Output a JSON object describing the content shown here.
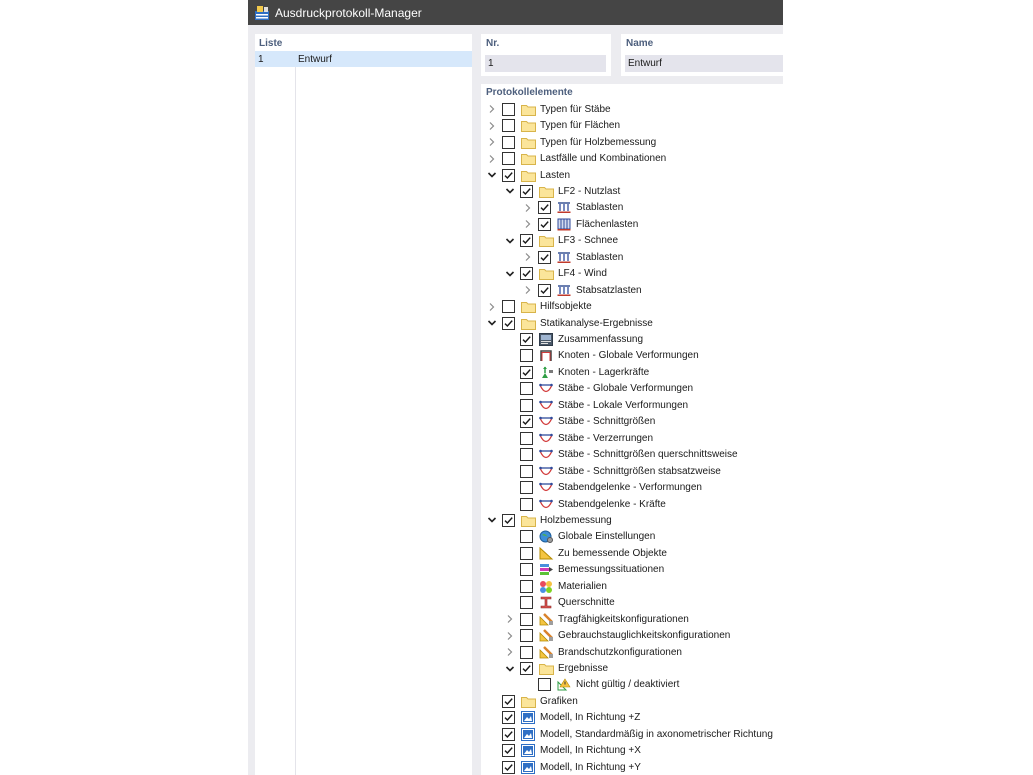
{
  "window": {
    "title": "Ausdruckprotokoll-Manager"
  },
  "list_panel": {
    "header": "Liste",
    "rows": [
      {
        "nr": "1",
        "name": "Entwurf"
      }
    ]
  },
  "nr_field": {
    "label": "Nr.",
    "value": "1"
  },
  "name_field": {
    "label": "Name",
    "value": "Entwurf"
  },
  "tree": {
    "header": "Protokollelemente",
    "items": [
      {
        "label": "Typen für Stäbe",
        "level": 0,
        "expander": "collapsed",
        "checked": false,
        "icon": "folder-icon"
      },
      {
        "label": "Typen für Flächen",
        "level": 0,
        "expander": "collapsed",
        "checked": false,
        "icon": "folder-icon"
      },
      {
        "label": "Typen für Holzbemessung",
        "level": 0,
        "expander": "collapsed",
        "checked": false,
        "icon": "folder-icon"
      },
      {
        "label": "Lastfälle und Kombinationen",
        "level": 0,
        "expander": "collapsed",
        "checked": false,
        "icon": "folder-icon"
      },
      {
        "label": "Lasten",
        "level": 0,
        "expander": "expanded",
        "checked": true,
        "icon": "folder-icon"
      },
      {
        "label": "LF2 - Nutzlast",
        "level": 1,
        "expander": "expanded",
        "checked": true,
        "icon": "folder-icon"
      },
      {
        "label": "Stablasten",
        "level": 2,
        "expander": "collapsed",
        "checked": true,
        "icon": "member-load-icon"
      },
      {
        "label": "Flächenlasten",
        "level": 2,
        "expander": "collapsed",
        "checked": true,
        "icon": "surface-load-icon"
      },
      {
        "label": "LF3 - Schnee",
        "level": 1,
        "expander": "expanded",
        "checked": true,
        "icon": "folder-icon"
      },
      {
        "label": "Stablasten",
        "level": 2,
        "expander": "collapsed",
        "checked": true,
        "icon": "member-load-icon"
      },
      {
        "label": "LF4 - Wind",
        "level": 1,
        "expander": "expanded",
        "checked": true,
        "icon": "folder-icon"
      },
      {
        "label": "Stabsatzlasten",
        "level": 2,
        "expander": "collapsed",
        "checked": true,
        "icon": "member-load-icon"
      },
      {
        "label": "Hilfsobjekte",
        "level": 0,
        "expander": "collapsed",
        "checked": false,
        "icon": "folder-icon"
      },
      {
        "label": "Statikanalyse-Ergebnisse",
        "level": 0,
        "expander": "expanded",
        "checked": true,
        "icon": "folder-icon"
      },
      {
        "label": "Zusammenfassung",
        "level": 1,
        "expander": "none",
        "checked": true,
        "icon": "summary-icon"
      },
      {
        "label": "Knoten - Globale Verformungen",
        "level": 1,
        "expander": "none",
        "checked": false,
        "icon": "node-deformation-icon"
      },
      {
        "label": "Knoten - Lagerkräfte",
        "level": 1,
        "expander": "none",
        "checked": true,
        "icon": "support-force-icon"
      },
      {
        "label": "Stäbe - Globale Verformungen",
        "level": 1,
        "expander": "none",
        "checked": false,
        "icon": "member-result-icon"
      },
      {
        "label": "Stäbe - Lokale Verformungen",
        "level": 1,
        "expander": "none",
        "checked": false,
        "icon": "member-result-icon"
      },
      {
        "label": "Stäbe - Schnittgrößen",
        "level": 1,
        "expander": "none",
        "checked": true,
        "icon": "member-result-icon"
      },
      {
        "label": "Stäbe - Verzerrungen",
        "level": 1,
        "expander": "none",
        "checked": false,
        "icon": "member-result-icon"
      },
      {
        "label": "Stäbe - Schnittgrößen querschnittsweise",
        "level": 1,
        "expander": "none",
        "checked": false,
        "icon": "member-result-icon"
      },
      {
        "label": "Stäbe - Schnittgrößen stabsatzweise",
        "level": 1,
        "expander": "none",
        "checked": false,
        "icon": "member-result-icon"
      },
      {
        "label": "Stabendgelenke - Verformungen",
        "level": 1,
        "expander": "none",
        "checked": false,
        "icon": "member-result-icon"
      },
      {
        "label": "Stabendgelenke - Kräfte",
        "level": 1,
        "expander": "none",
        "checked": false,
        "icon": "member-result-icon"
      },
      {
        "label": "Holzbemessung",
        "level": 0,
        "expander": "expanded",
        "checked": true,
        "icon": "folder-icon"
      },
      {
        "label": "Globale Einstellungen",
        "level": 1,
        "expander": "none",
        "checked": false,
        "icon": "globe-settings-icon"
      },
      {
        "label": "Zu bemessende Objekte",
        "level": 1,
        "expander": "none",
        "checked": false,
        "icon": "design-objects-icon"
      },
      {
        "label": "Bemessungssituationen",
        "level": 1,
        "expander": "none",
        "checked": false,
        "icon": "design-situations-icon"
      },
      {
        "label": "Materialien",
        "level": 1,
        "expander": "none",
        "checked": false,
        "icon": "materials-icon"
      },
      {
        "label": "Querschnitte",
        "level": 1,
        "expander": "none",
        "checked": false,
        "icon": "cross-section-icon"
      },
      {
        "label": "Tragfähigkeitskonfigurationen",
        "level": 1,
        "expander": "collapsed",
        "checked": false,
        "icon": "configuration-icon"
      },
      {
        "label": "Gebrauchstauglichkeitskonfigurationen",
        "level": 1,
        "expander": "collapsed",
        "checked": false,
        "icon": "configuration-icon"
      },
      {
        "label": "Brandschutzkonfigurationen",
        "level": 1,
        "expander": "collapsed",
        "checked": false,
        "icon": "configuration-icon"
      },
      {
        "label": "Ergebnisse",
        "level": 1,
        "expander": "expanded",
        "checked": true,
        "icon": "folder-icon"
      },
      {
        "label": "Nicht gültig / deaktiviert",
        "level": 2,
        "expander": "none",
        "checked": false,
        "icon": "invalid-warning-icon"
      },
      {
        "label": "Grafiken",
        "level": 0,
        "expander": "none",
        "checked": true,
        "icon": "folder-icon"
      },
      {
        "label": "Modell, In Richtung +Z",
        "level": 0,
        "expander": "none",
        "checked": true,
        "icon": "graphic-image-icon"
      },
      {
        "label": "Modell, Standardmäßig in axonometrischer Richtung",
        "level": 0,
        "expander": "none",
        "checked": true,
        "icon": "graphic-image-icon"
      },
      {
        "label": "Modell, In Richtung +X",
        "level": 0,
        "expander": "none",
        "checked": true,
        "icon": "graphic-image-icon"
      },
      {
        "label": "Modell, In Richtung +Y",
        "level": 0,
        "expander": "none",
        "checked": true,
        "icon": "graphic-image-icon"
      }
    ]
  }
}
